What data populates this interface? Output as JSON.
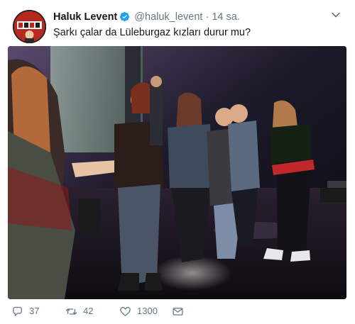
{
  "tweet": {
    "display_name": "Haluk Levent",
    "handle": "@haluk_levent",
    "separator": "·",
    "time": "14 sa.",
    "text": "Şarkı çalar da Lüleburgaz kızları durur mu?",
    "avatar_icon": "avatar-image",
    "verified_icon": "verified-badge-icon",
    "menu_icon": "chevron-down-icon",
    "media_description_icon": "photo-image"
  },
  "actions": {
    "reply_count": "37",
    "retweet_count": "42",
    "like_count": "1300",
    "reply_icon": "reply-icon",
    "retweet_icon": "retweet-icon",
    "like_icon": "heart-icon",
    "dm_icon": "envelope-icon"
  },
  "colors": {
    "text": "#14171a",
    "secondary": "#657786",
    "verified": "#1da1f2"
  }
}
